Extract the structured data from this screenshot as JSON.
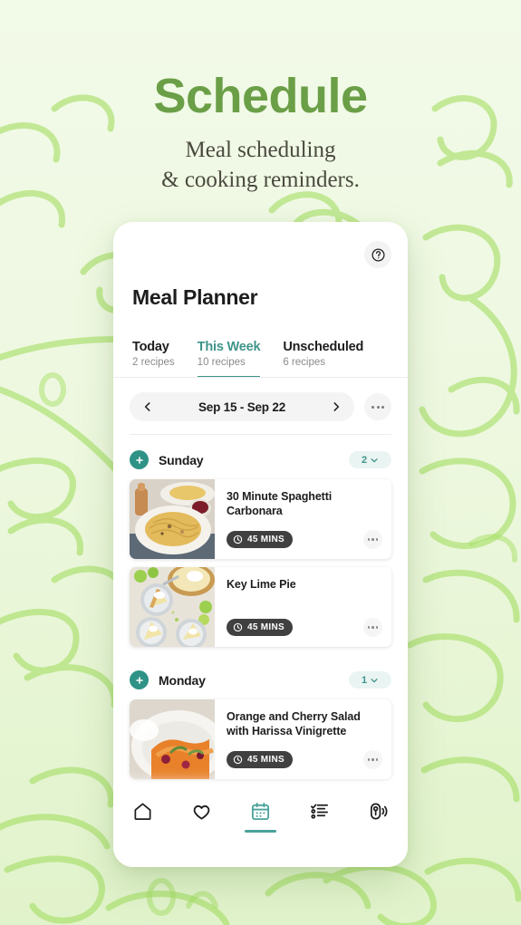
{
  "hero": {
    "title": "Schedule",
    "subtitle_line1": "Meal scheduling",
    "subtitle_line2": "& cooking reminders."
  },
  "colors": {
    "hero_green": "#6b9f47",
    "accent_teal": "#3f9489",
    "plus_teal": "#2f9287",
    "page_bg": "#f0f9e2",
    "doodle_green": "#a9e06a",
    "pill_dark": "#404040"
  },
  "app": {
    "help_icon": "question-circle-icon",
    "title": "Meal Planner",
    "tabs": [
      {
        "label": "Today",
        "sub": "2 recipes",
        "active": false
      },
      {
        "label": "This Week",
        "sub": "10 recipes",
        "active": true
      },
      {
        "label": "Unscheduled",
        "sub": "6 recipes",
        "active": false
      }
    ],
    "date_nav": {
      "prev_icon": "chevron-left-icon",
      "range": "Sep 15 - Sep 22",
      "next_icon": "chevron-right-icon",
      "overflow_icon": "ellipsis-icon"
    },
    "days": [
      {
        "name": "Sunday",
        "add_icon": "plus-circle-icon",
        "count": "2",
        "chevron_icon": "chevron-down-icon",
        "recipes": [
          {
            "name": "30 Minute Spaghetti Carbonara",
            "time": "45 MINS",
            "clock_icon": "clock-icon",
            "menu_icon": "ellipsis-icon",
            "thumb": "spaghetti-carbonara-photo"
          },
          {
            "name": "Key Lime Pie",
            "time": "45 MINS",
            "clock_icon": "clock-icon",
            "menu_icon": "ellipsis-icon",
            "thumb": "key-lime-pie-photo"
          }
        ]
      },
      {
        "name": "Monday",
        "add_icon": "plus-circle-icon",
        "count": "1",
        "chevron_icon": "chevron-down-icon",
        "recipes": [
          {
            "name": "Orange and Cherry Salad with Harissa Vinigrette",
            "time": "45 MINS",
            "clock_icon": "clock-icon",
            "menu_icon": "ellipsis-icon",
            "thumb": "orange-cherry-salad-photo"
          }
        ]
      }
    ],
    "bottom_nav": [
      {
        "icon": "home-icon",
        "active": false
      },
      {
        "icon": "heart-icon",
        "active": false
      },
      {
        "icon": "calendar-icon",
        "active": true
      },
      {
        "icon": "checklist-icon",
        "active": false
      },
      {
        "icon": "voice-device-icon",
        "active": false
      }
    ]
  }
}
